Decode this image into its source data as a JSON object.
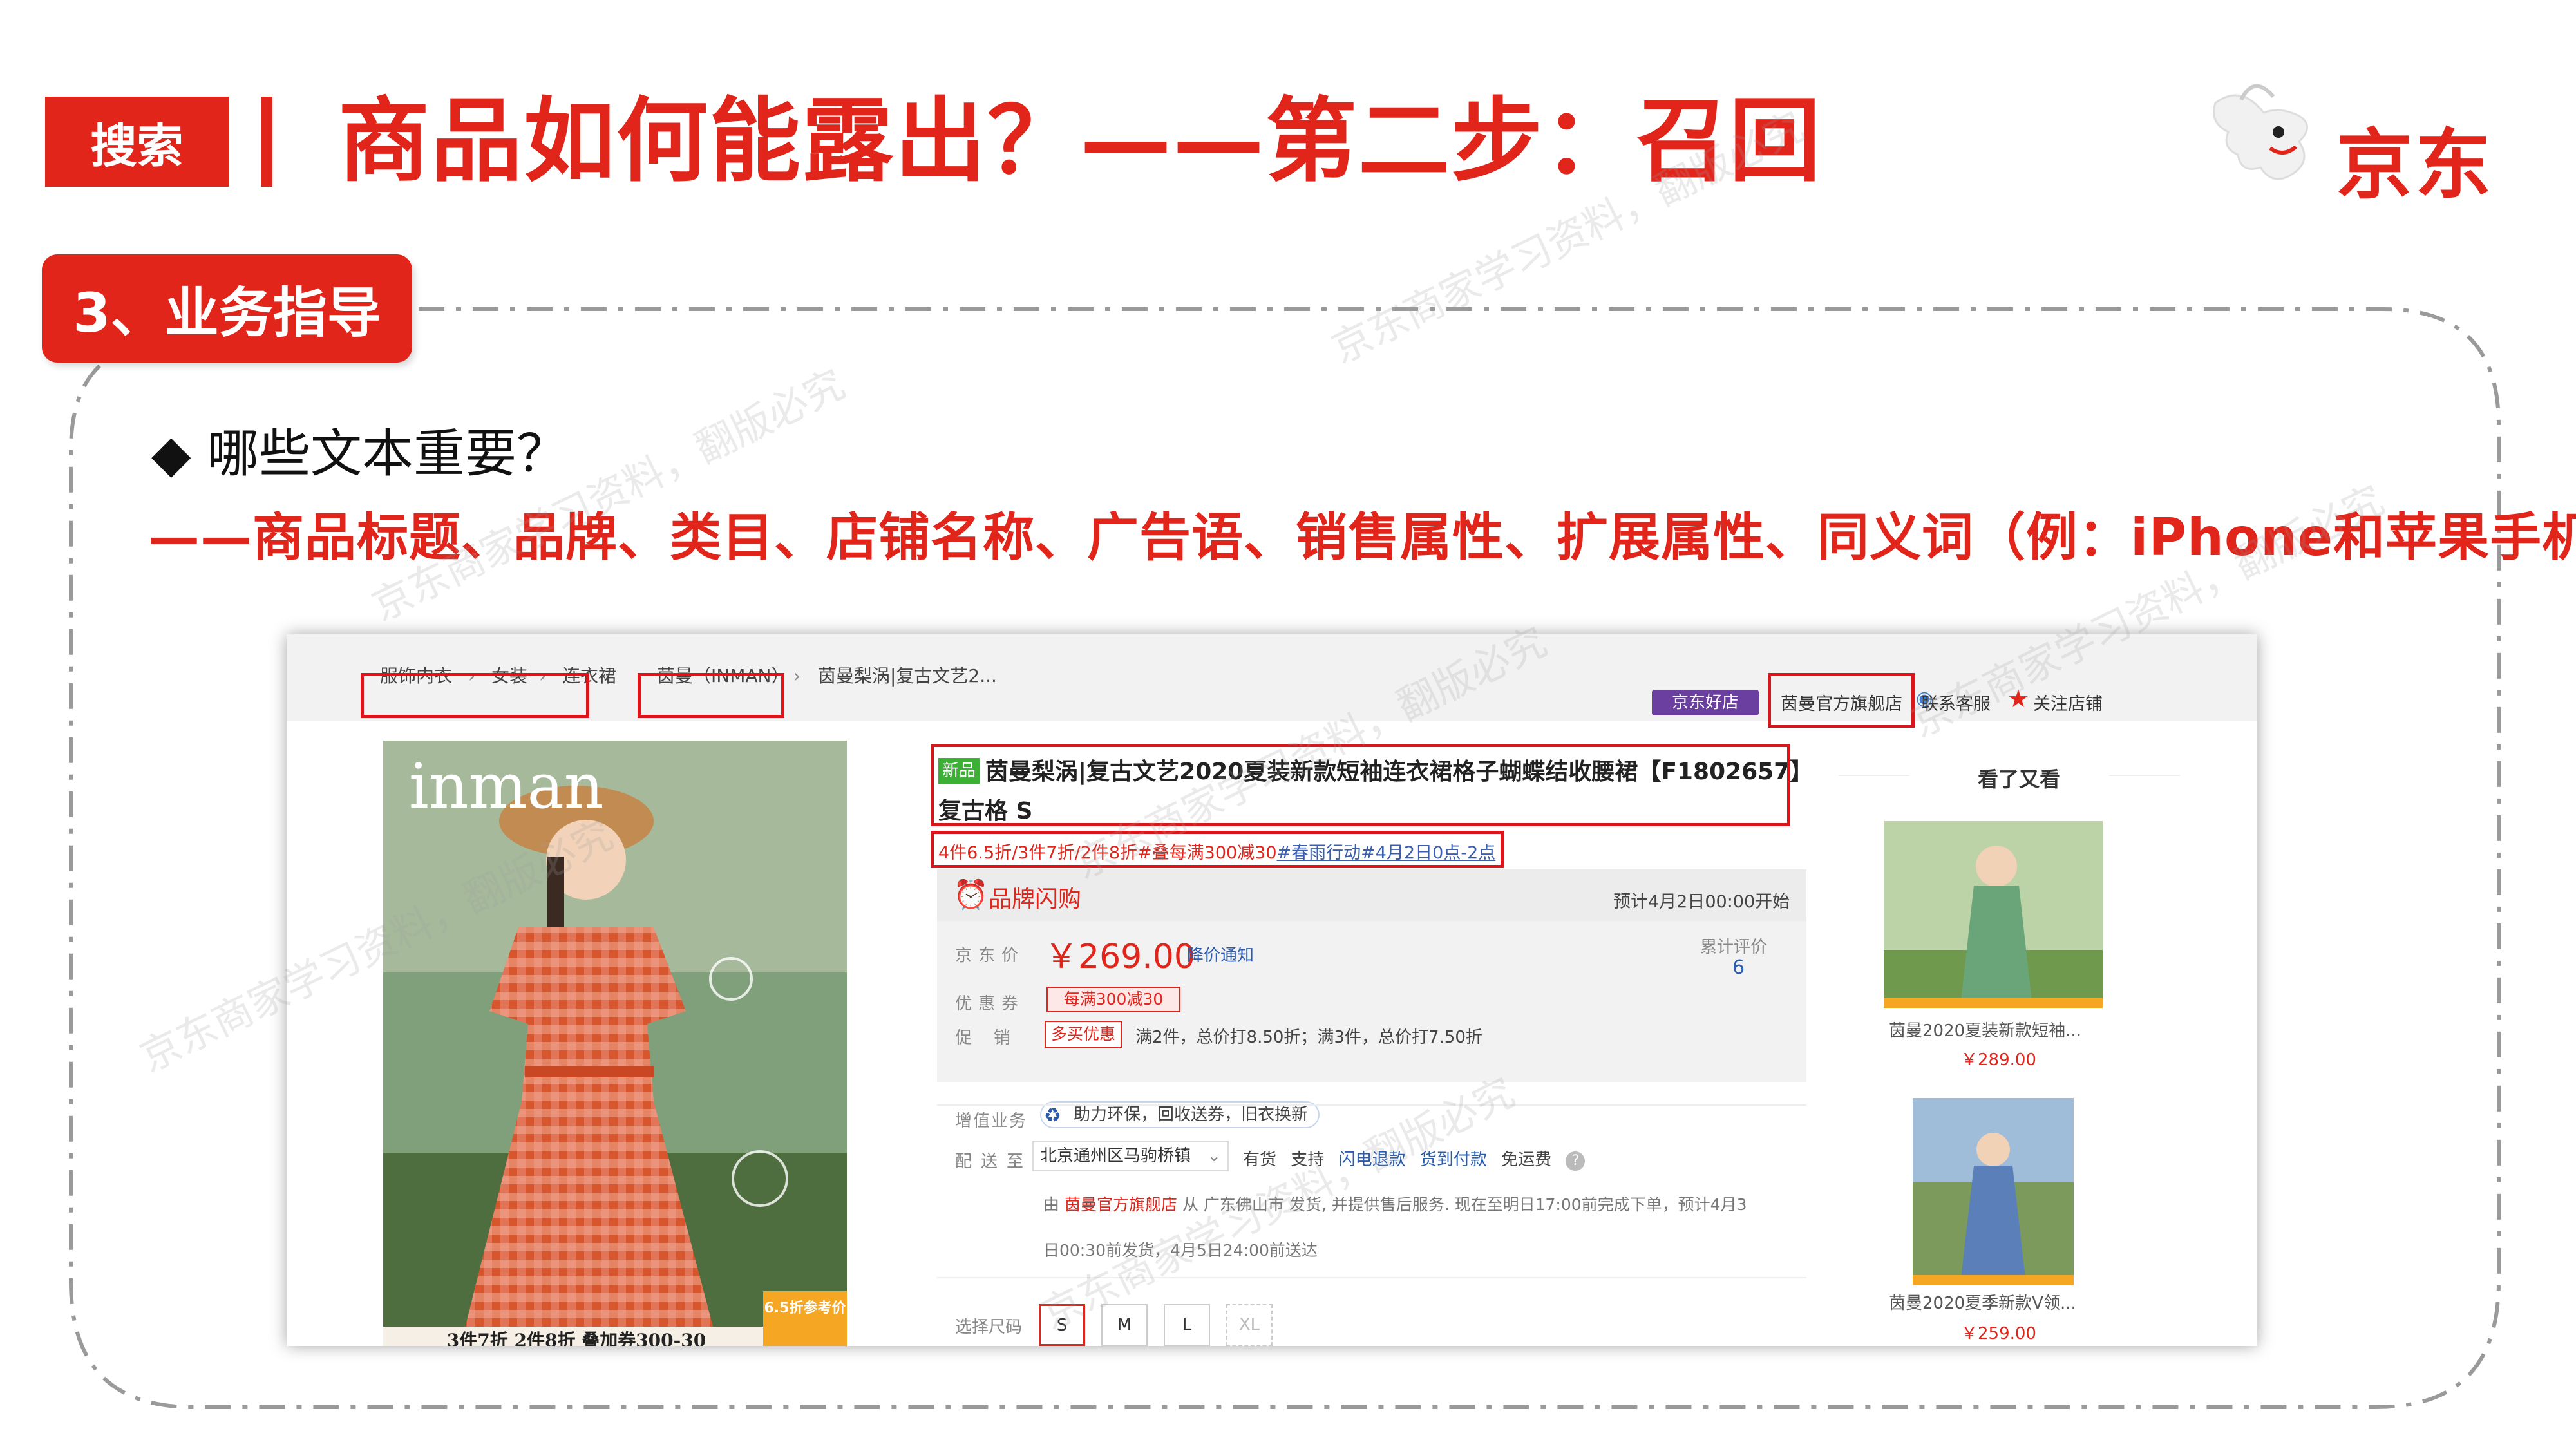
{
  "header": {
    "tag": "搜索",
    "title": "商品如何能露出？——第二步：召回",
    "logo_text": "京东"
  },
  "section": {
    "pill": "3、业务指导",
    "question": "◆ 哪些文本重要？",
    "answer": "——商品标题、品牌、类目、店铺名称、广告语、销售属性、扩展属性、同义词（例：iPhone和苹果手机）"
  },
  "screenshot": {
    "breadcrumbs": [
      {
        "label": "服饰内衣"
      },
      {
        "label": "女装"
      },
      {
        "label": "连衣裙"
      },
      {
        "label": "茵曼（INMAN）"
      },
      {
        "label": "茵曼梨涡|复古文艺2..."
      }
    ],
    "good_shop_badge": "京东好店",
    "shop_name": "茵曼官方旗舰店",
    "contact_service": "联系客服",
    "follow_shop": "关注店铺",
    "image_brand": "inman",
    "image_promo": "3件7折 2件8折 叠加券300-30",
    "image_badge": "6.5折参考价",
    "new_tag": "新品",
    "product_title": "茵曼梨涡|复古文艺2020夏装新款短袖连衣裙格子蝴蝶结收腰裙【F1802657】",
    "product_title_line2": "复古格 S",
    "slogan_text": "4件6.5折/3件7折/2件8折#叠每满300减30",
    "slogan_link": "#春雨行动#4月2日0点-2点",
    "flash_label": "品牌闪购",
    "flash_time": "预计4月2日00:00开始",
    "price_label": "京东价",
    "price": "￥269.00",
    "price_notice": "降价通知",
    "review_label": "累计评价",
    "review_count": "6",
    "coupon_label": "优惠券",
    "coupon": "每满300减30",
    "promo_label": "促销",
    "promo_tag": "多买优惠",
    "promo_text": "满2件，总价打8.50折；满3件，总价打7.50折",
    "value_added_label": "增值业务",
    "value_added": "助力环保，回收送券，旧衣换新",
    "delivery_label": "配送至",
    "delivery_address": "北京通州区马驹桥镇",
    "delivery_opts": {
      "stock": "有货",
      "support": "支持",
      "flash_refund": "闪电退款",
      "cod": "货到付款",
      "free_ship": "免运费"
    },
    "ship_note_prefix": "由",
    "ship_note_shop": "茵曼官方旗舰店",
    "ship_note_rest": "从 广东佛山市 发货, 并提供售后服务. 现在至明日17:00前完成下单，预计4月3",
    "ship_note_line2": "日00:30前发货，4月5日24:00前送达",
    "size_label": "选择尺码",
    "sizes": [
      "S",
      "M",
      "L",
      "XL"
    ],
    "side_title": "看了又看",
    "side_items": [
      {
        "name": "茵曼2020夏装新款短袖...",
        "price": "￥289.00"
      },
      {
        "name": "茵曼2020夏季新款V领...",
        "price": "￥259.00"
      }
    ]
  },
  "colors": {
    "brand_red": "#e1251b",
    "link_blue": "#2a5db0",
    "new_green": "#3cb035"
  },
  "watermark": "京东商家学习资料，翻版必究"
}
